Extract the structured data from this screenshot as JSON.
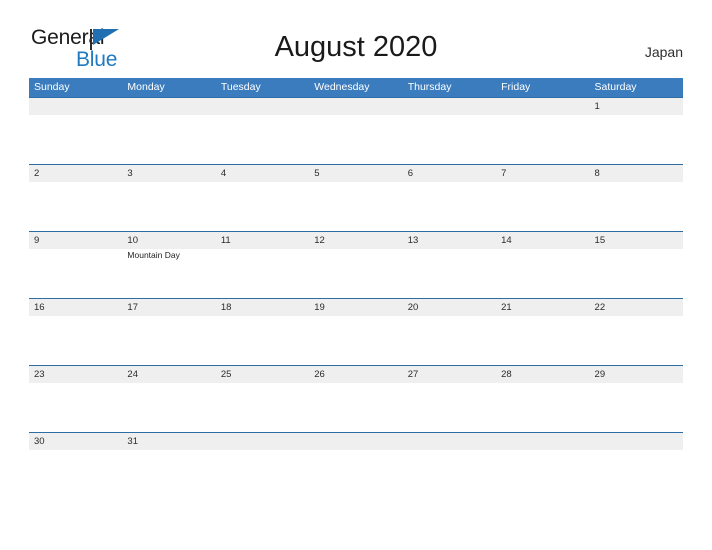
{
  "brand": {
    "name_part1": "General",
    "name_part2": "Blue",
    "flag_icon": "flag-icon"
  },
  "header": {
    "title": "August 2020",
    "region": "Japan"
  },
  "colors": {
    "header_blue": "#3b7cbe",
    "row_rule_blue": "#2e6da4",
    "band_gray": "#efefef",
    "brand_blue": "#1f7ac0",
    "text_dark": "#1a1a1a"
  },
  "calendar": {
    "month": "August",
    "year": "2020",
    "weekday_headers": [
      "Sunday",
      "Monday",
      "Tuesday",
      "Wednesday",
      "Thursday",
      "Friday",
      "Saturday"
    ],
    "weeks": [
      {
        "days": [
          {
            "number": "",
            "events": []
          },
          {
            "number": "",
            "events": []
          },
          {
            "number": "",
            "events": []
          },
          {
            "number": "",
            "events": []
          },
          {
            "number": "",
            "events": []
          },
          {
            "number": "",
            "events": []
          },
          {
            "number": "1",
            "events": []
          }
        ]
      },
      {
        "days": [
          {
            "number": "2",
            "events": []
          },
          {
            "number": "3",
            "events": []
          },
          {
            "number": "4",
            "events": []
          },
          {
            "number": "5",
            "events": []
          },
          {
            "number": "6",
            "events": []
          },
          {
            "number": "7",
            "events": []
          },
          {
            "number": "8",
            "events": []
          }
        ]
      },
      {
        "days": [
          {
            "number": "9",
            "events": []
          },
          {
            "number": "10",
            "events": [
              "Mountain Day"
            ]
          },
          {
            "number": "11",
            "events": []
          },
          {
            "number": "12",
            "events": []
          },
          {
            "number": "13",
            "events": []
          },
          {
            "number": "14",
            "events": []
          },
          {
            "number": "15",
            "events": []
          }
        ]
      },
      {
        "days": [
          {
            "number": "16",
            "events": []
          },
          {
            "number": "17",
            "events": []
          },
          {
            "number": "18",
            "events": []
          },
          {
            "number": "19",
            "events": []
          },
          {
            "number": "20",
            "events": []
          },
          {
            "number": "21",
            "events": []
          },
          {
            "number": "22",
            "events": []
          }
        ]
      },
      {
        "days": [
          {
            "number": "23",
            "events": []
          },
          {
            "number": "24",
            "events": []
          },
          {
            "number": "25",
            "events": []
          },
          {
            "number": "26",
            "events": []
          },
          {
            "number": "27",
            "events": []
          },
          {
            "number": "28",
            "events": []
          },
          {
            "number": "29",
            "events": []
          }
        ]
      },
      {
        "days": [
          {
            "number": "30",
            "events": []
          },
          {
            "number": "31",
            "events": []
          },
          {
            "number": "",
            "events": []
          },
          {
            "number": "",
            "events": []
          },
          {
            "number": "",
            "events": []
          },
          {
            "number": "",
            "events": []
          },
          {
            "number": "",
            "events": []
          }
        ]
      }
    ]
  }
}
